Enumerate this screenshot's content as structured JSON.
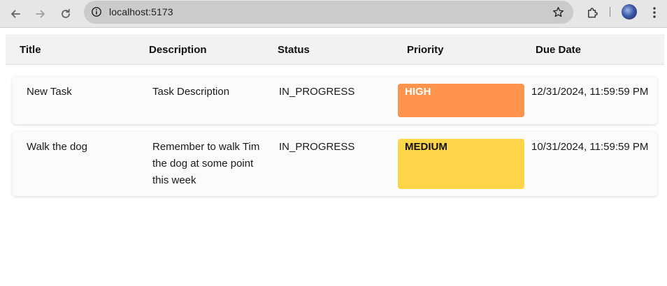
{
  "browser": {
    "url": "localhost:5173",
    "icons": {
      "back": "arrow-left-icon",
      "forward": "arrow-right-icon",
      "reload": "reload-icon",
      "site_info": "info-icon",
      "bookmark": "star-icon",
      "extensions": "puzzle-icon",
      "menu": "kebab-menu-icon"
    }
  },
  "table": {
    "headers": {
      "title": "Title",
      "description": "Description",
      "status": "Status",
      "priority": "Priority",
      "due_date": "Due Date"
    },
    "rows": [
      {
        "title": "New Task",
        "description": "Task Description",
        "status": "IN_PROGRESS",
        "priority": "HIGH",
        "priority_bg": "#ff944d",
        "priority_color": "#ffffff",
        "due_date": "12/31/2024, 11:59:59 PM"
      },
      {
        "title": "Walk the dog",
        "description": "Remember to walk Tim the dog at some point this week",
        "status": "IN_PROGRESS",
        "priority": "MEDIUM",
        "priority_bg": "#ffd54a",
        "priority_color": "#111111",
        "due_date": "10/31/2024, 11:59:59 PM"
      }
    ]
  },
  "colors": {
    "chrome_bg": "#e6e6e6",
    "omnibox_bg": "#cbcbcb",
    "header_bg": "#f2f2f2",
    "card_bg": "#fbfbfb"
  }
}
